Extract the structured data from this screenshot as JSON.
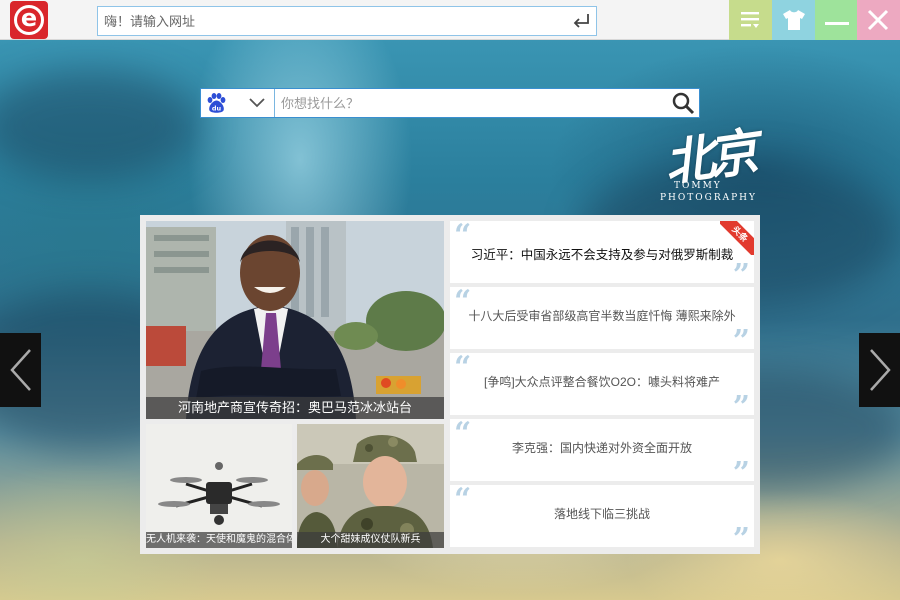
{
  "topbar": {
    "logo_letter": "e",
    "url_placeholder": "嗨！请输入网址",
    "buttons": [
      "menu-icon",
      "tshirt-icon",
      "minimize-icon",
      "close-icon"
    ]
  },
  "search": {
    "engine": "baidu-icon",
    "placeholder": "你想找什么？"
  },
  "decoration": {
    "calligraphy": "北京",
    "line1": "TOMMY",
    "line2": "PHOTOGRAPHY"
  },
  "featured": {
    "main_caption": "河南地产商宣传奇招：奥巴马范冰冰站台",
    "small": [
      {
        "caption": "无人机来袭：天使和魔鬼的混合体"
      },
      {
        "caption": "大个甜妹成仪仗队新兵"
      }
    ]
  },
  "news": [
    {
      "title": "习近平：中国永远不会支持及参与对俄罗斯制裁",
      "badge": "头条"
    },
    {
      "title": "十八大后受审省部级高官半数当庭忏悔 薄熙来除外"
    },
    {
      "title": "[争鸣]大众点评整合餐饮O2O：噱头料将难产"
    },
    {
      "title": "李克强：国内快递对外资全面开放"
    },
    {
      "title": "落地线下临三挑战"
    }
  ],
  "colors": {
    "logo_red": "#d9262b",
    "btn_menu": "#c6dc8c",
    "btn_skin": "#8fd3e0",
    "btn_min": "#9ee39b",
    "btn_close": "#eda9c1",
    "badge_red": "#e23a2e"
  }
}
